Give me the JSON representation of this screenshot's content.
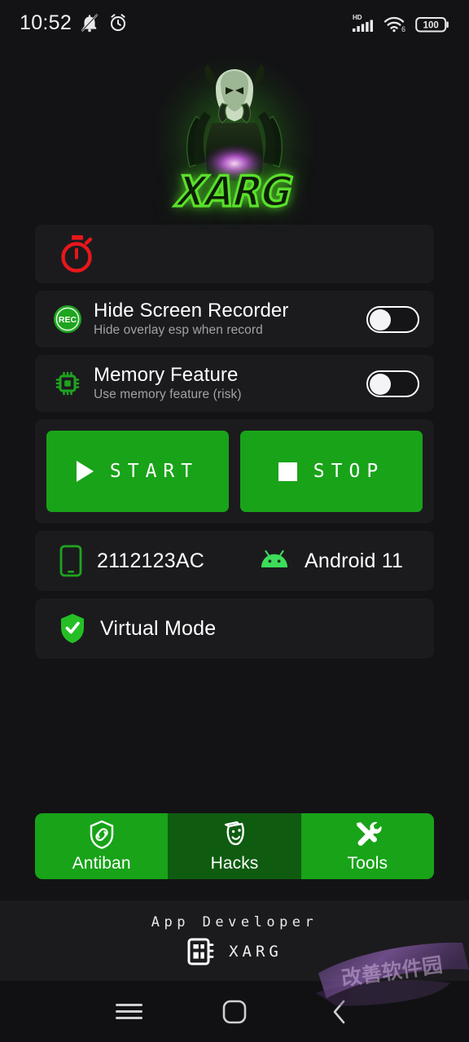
{
  "status_bar": {
    "time": "10:52",
    "icons_left": [
      "bell-muted-icon",
      "alarm-clock-icon"
    ],
    "network_label": "HD",
    "wifi_label": "6",
    "battery_level": "100"
  },
  "logo": {
    "wordmark": "XARG",
    "icon_name": "xarg-predator-logo",
    "glow_color": "#4adc28"
  },
  "timer_card": {
    "icon_name": "stopwatch-icon",
    "icon_color": "#e8171b"
  },
  "toggles": [
    {
      "icon_name": "rec-badge-icon",
      "title": "Hide Screen Recorder",
      "subtitle": "Hide overlay esp when record",
      "state": "off"
    },
    {
      "icon_name": "memory-chip-icon",
      "title": "Memory Feature",
      "subtitle": "Use memory feature (risk)",
      "state": "off"
    }
  ],
  "actions": {
    "start_label": "START",
    "stop_label": "STOP",
    "button_color": "#19a319"
  },
  "device": {
    "model": "2112123AC",
    "model_icon": "phone-icon",
    "os": "Android 11",
    "os_icon": "android-robot-icon",
    "mode": "Virtual Mode",
    "mode_icon": "shield-check-icon"
  },
  "tabs": [
    {
      "label": "Antiban",
      "icon_name": "shield-link-icon",
      "active": true
    },
    {
      "label": "Hacks",
      "icon_name": "theater-mask-icon",
      "active": false
    },
    {
      "label": "Tools",
      "icon_name": "wrench-screwdriver-icon",
      "active": true
    }
  ],
  "footer": {
    "title": "App Developer",
    "developer": "XARG",
    "icon_name": "contacts-grid-icon"
  },
  "nav_bar": {
    "recents_icon": "hamburger-icon",
    "home_icon": "rounded-square-icon",
    "back_icon": "chevron-left-icon"
  },
  "watermark": {
    "text": "改善软件园",
    "color": "#8b5fae"
  }
}
